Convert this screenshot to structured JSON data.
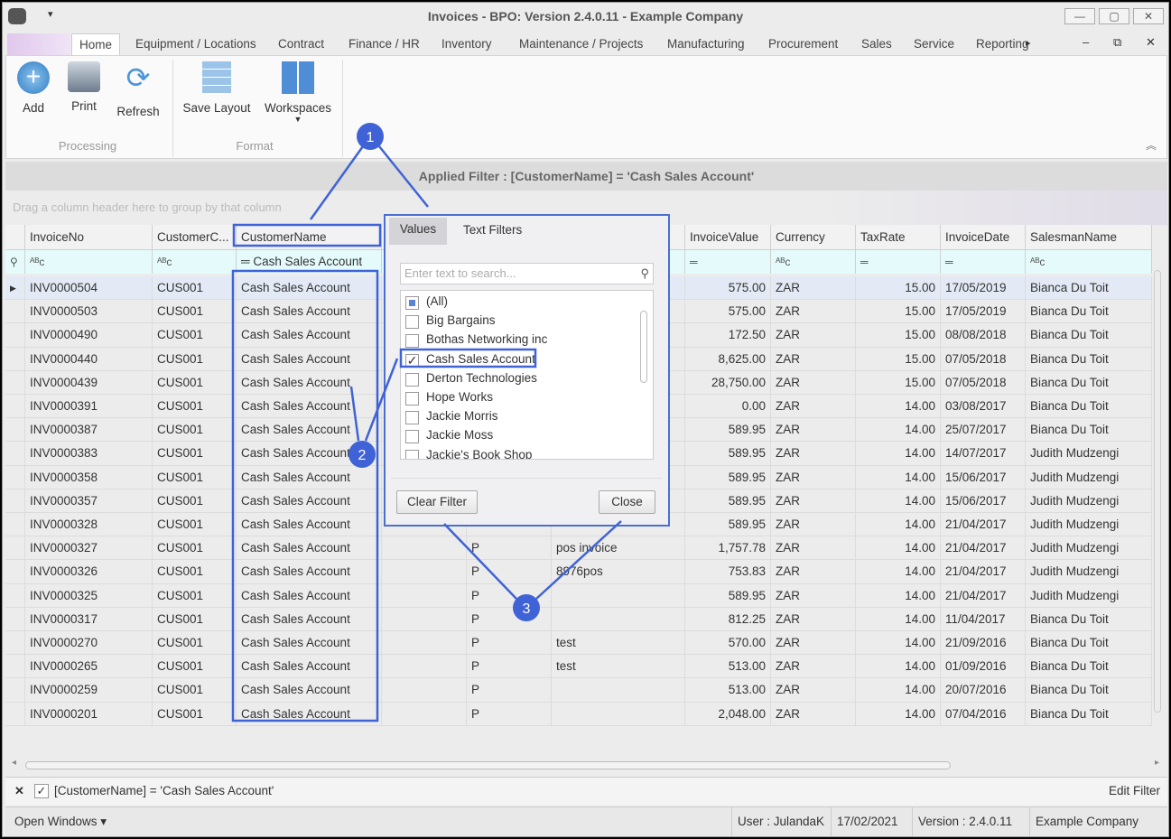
{
  "window": {
    "title": "Invoices - BPO: Version 2.4.0.11 - Example Company"
  },
  "tabs": [
    "Home",
    "Equipment / Locations",
    "Contract",
    "Finance / HR",
    "Inventory",
    "Maintenance / Projects",
    "Manufacturing",
    "Procurement",
    "Sales",
    "Service",
    "Reporting"
  ],
  "ribbon": {
    "buttons": [
      "Add",
      "Print",
      "Refresh",
      "Save Layout",
      "Workspaces"
    ],
    "groups": [
      "Processing",
      "Format"
    ]
  },
  "applied_filter": "Applied Filter : [CustomerName] = 'Cash Sales Account'",
  "group_panel": "Drag a column header here to group by that column",
  "columns": [
    "InvoiceNo",
    "CustomerC...",
    "CustomerName",
    "",
    "",
    "",
    "InvoiceValue",
    "Currency",
    "TaxRate",
    "InvoiceDate",
    "SalesmanName"
  ],
  "filter_row": {
    "customer_name": "Cash Sales Account"
  },
  "rows": [
    [
      "INV0000504",
      "CUS001",
      "Cash Sales Account",
      "",
      "",
      "",
      "575.00",
      "ZAR",
      "15.00",
      "17/05/2019",
      "Bianca Du Toit"
    ],
    [
      "INV0000503",
      "CUS001",
      "Cash Sales Account",
      "",
      "",
      "",
      "575.00",
      "ZAR",
      "15.00",
      "17/05/2019",
      "Bianca Du Toit"
    ],
    [
      "INV0000490",
      "CUS001",
      "Cash Sales Account",
      "",
      "",
      "",
      "172.50",
      "ZAR",
      "15.00",
      "08/08/2018",
      "Bianca Du Toit"
    ],
    [
      "INV0000440",
      "CUS001",
      "Cash Sales Account",
      "",
      "",
      "",
      "8,625.00",
      "ZAR",
      "15.00",
      "07/05/2018",
      "Bianca Du Toit"
    ],
    [
      "INV0000439",
      "CUS001",
      "Cash Sales Account",
      "",
      "",
      "",
      "28,750.00",
      "ZAR",
      "15.00",
      "07/05/2018",
      "Bianca Du Toit"
    ],
    [
      "INV0000391",
      "CUS001",
      "Cash Sales Account",
      "",
      "",
      "",
      "0.00",
      "ZAR",
      "14.00",
      "03/08/2017",
      "Bianca Du Toit"
    ],
    [
      "INV0000387",
      "CUS001",
      "Cash Sales Account",
      "",
      "",
      "",
      "589.95",
      "ZAR",
      "14.00",
      "25/07/2017",
      "Bianca Du Toit"
    ],
    [
      "INV0000383",
      "CUS001",
      "Cash Sales Account",
      "",
      "",
      "",
      "589.95",
      "ZAR",
      "14.00",
      "14/07/2017",
      "Judith Mudzengi"
    ],
    [
      "INV0000358",
      "CUS001",
      "Cash Sales Account",
      "",
      "",
      "",
      "589.95",
      "ZAR",
      "14.00",
      "15/06/2017",
      "Judith Mudzengi"
    ],
    [
      "INV0000357",
      "CUS001",
      "Cash Sales Account",
      "",
      "",
      "",
      "589.95",
      "ZAR",
      "14.00",
      "15/06/2017",
      "Judith Mudzengi"
    ],
    [
      "INV0000328",
      "CUS001",
      "Cash Sales Account",
      "",
      "",
      "",
      "589.95",
      "ZAR",
      "14.00",
      "21/04/2017",
      "Judith Mudzengi"
    ],
    [
      "INV0000327",
      "CUS001",
      "Cash Sales Account",
      "",
      "P",
      "pos invoice",
      "1,757.78",
      "ZAR",
      "14.00",
      "21/04/2017",
      "Judith Mudzengi"
    ],
    [
      "INV0000326",
      "CUS001",
      "Cash Sales Account",
      "",
      "P",
      "8976pos",
      "753.83",
      "ZAR",
      "14.00",
      "21/04/2017",
      "Judith Mudzengi"
    ],
    [
      "INV0000325",
      "CUS001",
      "Cash Sales Account",
      "",
      "P",
      "",
      "589.95",
      "ZAR",
      "14.00",
      "21/04/2017",
      "Judith Mudzengi"
    ],
    [
      "INV0000317",
      "CUS001",
      "Cash Sales Account",
      "",
      "P",
      "",
      "812.25",
      "ZAR",
      "14.00",
      "11/04/2017",
      "Bianca Du Toit"
    ],
    [
      "INV0000270",
      "CUS001",
      "Cash Sales Account",
      "",
      "P",
      "test",
      "570.00",
      "ZAR",
      "14.00",
      "21/09/2016",
      "Bianca Du Toit"
    ],
    [
      "INV0000265",
      "CUS001",
      "Cash Sales Account",
      "",
      "P",
      "test",
      "513.00",
      "ZAR",
      "14.00",
      "01/09/2016",
      "Bianca Du Toit"
    ],
    [
      "INV0000259",
      "CUS001",
      "Cash Sales Account",
      "",
      "P",
      "",
      "513.00",
      "ZAR",
      "14.00",
      "20/07/2016",
      "Bianca Du Toit"
    ],
    [
      "INV0000201",
      "CUS001",
      "Cash Sales Account",
      "",
      "P",
      "",
      "2,048.00",
      "ZAR",
      "14.00",
      "07/04/2016",
      "Bianca Du Toit"
    ]
  ],
  "popup": {
    "tabs": [
      "Values",
      "Text Filters"
    ],
    "search_placeholder": "Enter text to search...",
    "items": [
      {
        "label": "(All)",
        "state": "partial"
      },
      {
        "label": "Big Bargains",
        "state": "unchecked"
      },
      {
        "label": "Bothas Networking inc",
        "state": "unchecked"
      },
      {
        "label": "Cash Sales Account",
        "state": "checked"
      },
      {
        "label": "Derton Technologies",
        "state": "unchecked"
      },
      {
        "label": "Hope Works",
        "state": "unchecked"
      },
      {
        "label": "Jackie Morris",
        "state": "unchecked"
      },
      {
        "label": "Jackie Moss",
        "state": "unchecked"
      },
      {
        "label": "Jackie's Book Shop",
        "state": "unchecked"
      }
    ],
    "clear_label": "Clear Filter",
    "close_label": "Close"
  },
  "filter_panel": {
    "text": "[CustomerName] = 'Cash Sales Account'",
    "edit": "Edit Filter"
  },
  "status": {
    "open_windows": "Open Windows",
    "user": "User : JulandaK",
    "date": "17/02/2021",
    "version": "Version : 2.4.0.11",
    "company": "Example Company"
  },
  "callouts": [
    "1",
    "2",
    "3"
  ],
  "accent": "#3f63d6"
}
